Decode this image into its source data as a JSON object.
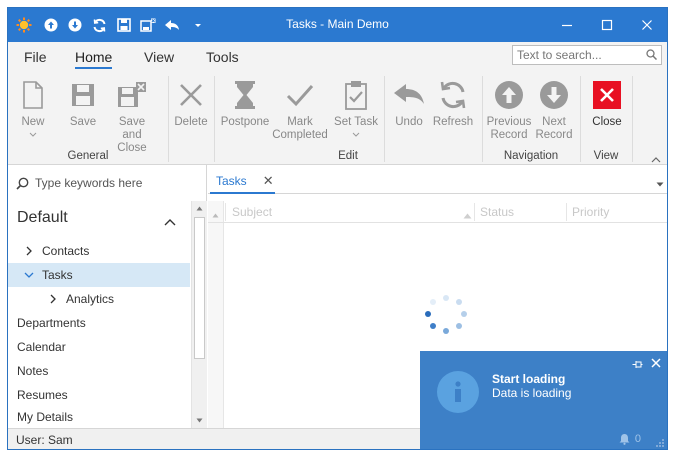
{
  "window": {
    "title": "Tasks - Main Demo"
  },
  "ribbon": {
    "tabs": [
      {
        "label": "File"
      },
      {
        "label": "Home"
      },
      {
        "label": "View"
      },
      {
        "label": "Tools"
      }
    ],
    "search_placeholder": "Text to search...",
    "buttons": {
      "new": "New",
      "save": "Save",
      "save_close": "Save and\nClose",
      "delete": "Delete",
      "postpone": "Postpone",
      "mark_completed": "Mark\nCompleted",
      "set_task": "Set Task",
      "undo": "Undo",
      "refresh": "Refresh",
      "previous_record": "Previous\nRecord",
      "next_record": "Next\nRecord",
      "close": "Close"
    },
    "groups": {
      "general": "General",
      "edit": "Edit",
      "navigation": "Navigation",
      "view": "View"
    }
  },
  "nav": {
    "search_placeholder": "Type keywords here",
    "header": "Default",
    "items": [
      {
        "label": "Contacts"
      },
      {
        "label": "Tasks"
      },
      {
        "label": "Analytics"
      },
      {
        "label": "Departments"
      },
      {
        "label": "Calendar"
      },
      {
        "label": "Notes"
      },
      {
        "label": "Resumes"
      },
      {
        "label": "My Details"
      }
    ]
  },
  "document": {
    "tab_label": "Tasks",
    "columns": [
      {
        "label": "Subject"
      },
      {
        "label": "Status"
      },
      {
        "label": "Priority"
      }
    ]
  },
  "alert": {
    "caption": "Start loading",
    "text": "Data is loading",
    "notification_count": "0"
  },
  "status": {
    "user": "User: Sam"
  },
  "colors": {
    "accent": "#2b79d0",
    "alert": "#3d80c7",
    "close_red": "#e81123",
    "selection": "#d6e8f6"
  }
}
